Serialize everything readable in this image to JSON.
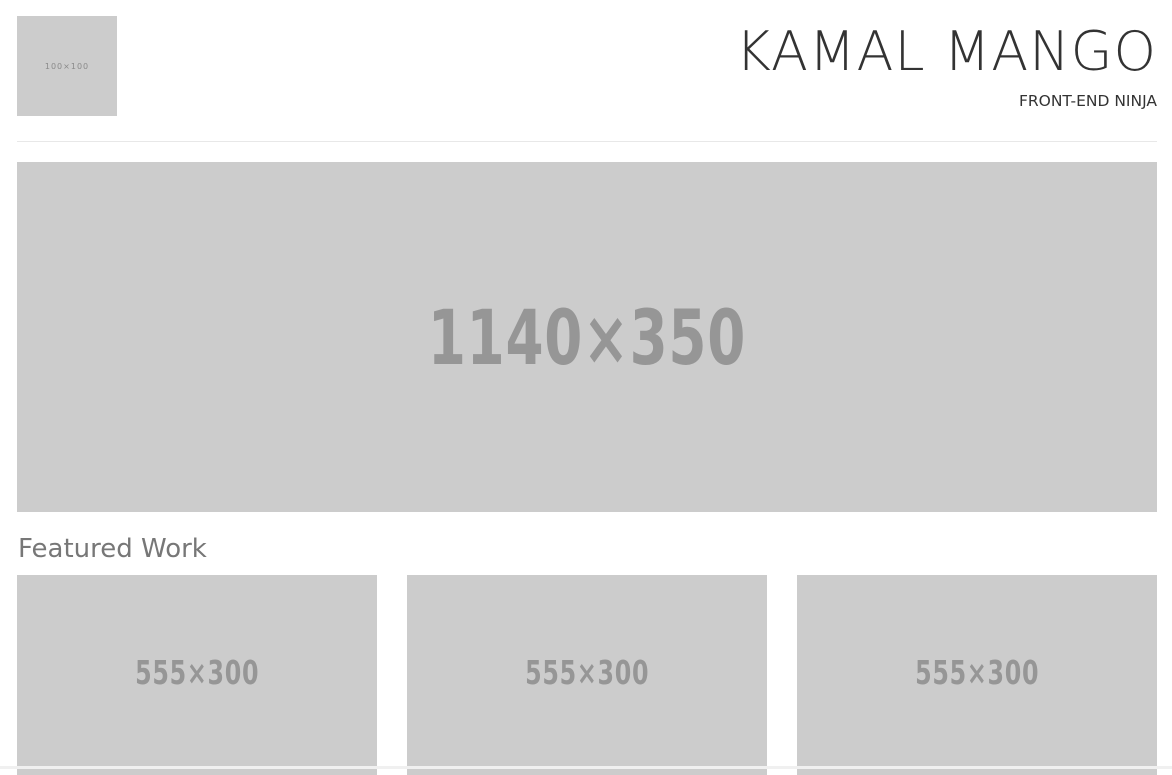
{
  "header": {
    "logo_placeholder": "100×100",
    "title": "KAMAL MANGO",
    "subtitle": "FRONT-END NINJA"
  },
  "hero": {
    "placeholder": "1140×350"
  },
  "featured": {
    "heading": "Featured Work",
    "items": [
      {
        "placeholder": "555×300"
      },
      {
        "placeholder": "555×300"
      },
      {
        "placeholder": "555×300"
      }
    ]
  },
  "colors": {
    "placeholder_bg": "#cccccc",
    "placeholder_text": "#969696",
    "title_text": "#333333",
    "heading_text": "#777777"
  }
}
